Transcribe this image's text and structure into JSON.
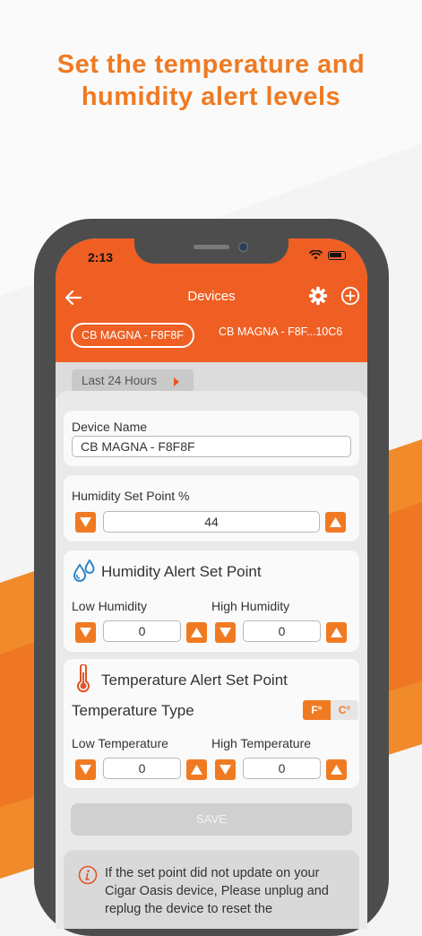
{
  "headline": {
    "line1": "Set the temperature and",
    "line2": "humidity alert levels"
  },
  "status_bar": {
    "time": "2:13"
  },
  "nav": {
    "title": "Devices",
    "back_icon": "arrow-left-icon",
    "settings_icon": "gear-icon",
    "add_icon": "plus-circle-icon"
  },
  "device_tabs": [
    {
      "label": "CB MAGNA - F8F8F",
      "active": true
    },
    {
      "label": "CB MAGNA - F8F...10C6",
      "active": false
    }
  ],
  "range": {
    "label": "Last 24 Hours"
  },
  "device_name": {
    "label": "Device Name",
    "value": "CB MAGNA - F8F8F"
  },
  "humidity_set_point": {
    "label": "Humidity Set Point %",
    "value": "44"
  },
  "humidity_alert": {
    "title": "Humidity Alert Set Point",
    "icon": "water-drops-icon",
    "low_label": "Low Humidity",
    "low_value": "0",
    "high_label": "High Humidity",
    "high_value": "0"
  },
  "temperature_alert": {
    "title": "Temperature Alert Set Point",
    "icon": "thermometer-icon",
    "type_label": "Temperature Type",
    "unit_f": "F°",
    "unit_c": "C°",
    "selected_unit": "F",
    "low_label": "Low Temperature",
    "low_value": "0",
    "high_label": "High Temperature",
    "high_value": "0"
  },
  "save": {
    "label": "SAVE"
  },
  "info": {
    "text": "If the set point did not update on your Cigar Oasis device, Please unplug and replug the device to reset the"
  },
  "colors": {
    "accent": "#ef5f23",
    "orange": "#f07a22",
    "headline": "#f07a22"
  }
}
